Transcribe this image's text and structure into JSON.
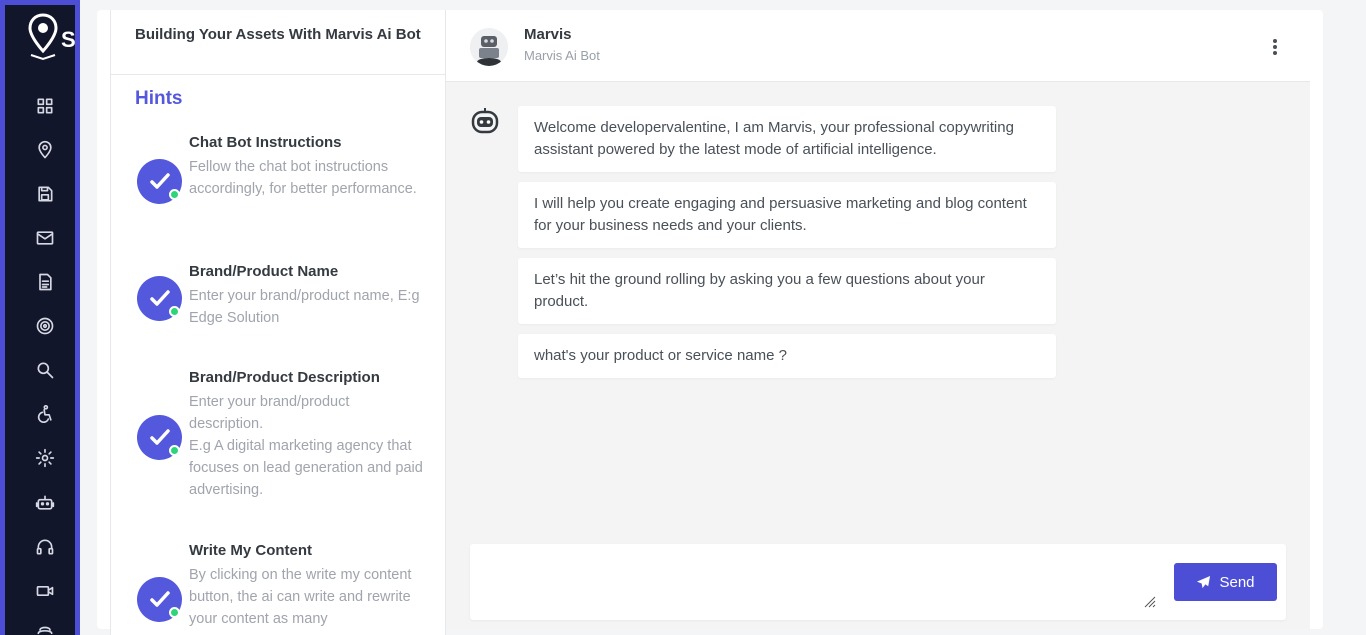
{
  "brand": {
    "logo_text": "SI",
    "accent_color": "#4c4fd6",
    "sidebar_color": "#12162a"
  },
  "sidebar": {
    "items": [
      {
        "icon": "dashboard-grid-icon"
      },
      {
        "icon": "map-pin-icon"
      },
      {
        "icon": "save-icon"
      },
      {
        "icon": "mail-icon"
      },
      {
        "icon": "document-icon"
      },
      {
        "icon": "target-icon"
      },
      {
        "icon": "search-icon"
      },
      {
        "icon": "accessibility-icon"
      },
      {
        "icon": "settings-gear-icon"
      },
      {
        "icon": "robot-icon"
      },
      {
        "icon": "headset-icon"
      },
      {
        "icon": "video-camera-icon"
      },
      {
        "icon": "more-icon"
      }
    ]
  },
  "left_panel": {
    "title": "Building Your Assets With Marvis Ai Bot",
    "hints_title": "Hints",
    "hints": [
      {
        "title": "Chat Bot Instructions",
        "text": "Fellow the chat bot instructions accordingly, for better performance."
      },
      {
        "title": "Brand/Product Name",
        "text": "Enter your brand/product name, E:g Edge Solution"
      },
      {
        "title": "Brand/Product Description",
        "text": "Enter your brand/product description.",
        "text2": "E.g A digital marketing agency that focuses on lead generation and paid advertising."
      },
      {
        "title": "Write My Content",
        "text": "By clicking on the write my content button, the ai can write and rewrite your content as many"
      }
    ]
  },
  "chat": {
    "name": "Marvis",
    "subtitle": "Marvis Ai Bot",
    "messages": [
      "Welcome developervalentine, I am Marvis, your professional copywriting assistant powered by the latest mode of artificial intelligence.",
      "I will help you create engaging and persuasive marketing and blog content for your business needs and your clients.",
      "Let’s hit the ground rolling by asking you a few questions about your product.",
      "what's your product or service name ?"
    ],
    "input_value": "",
    "send_label": "Send"
  }
}
